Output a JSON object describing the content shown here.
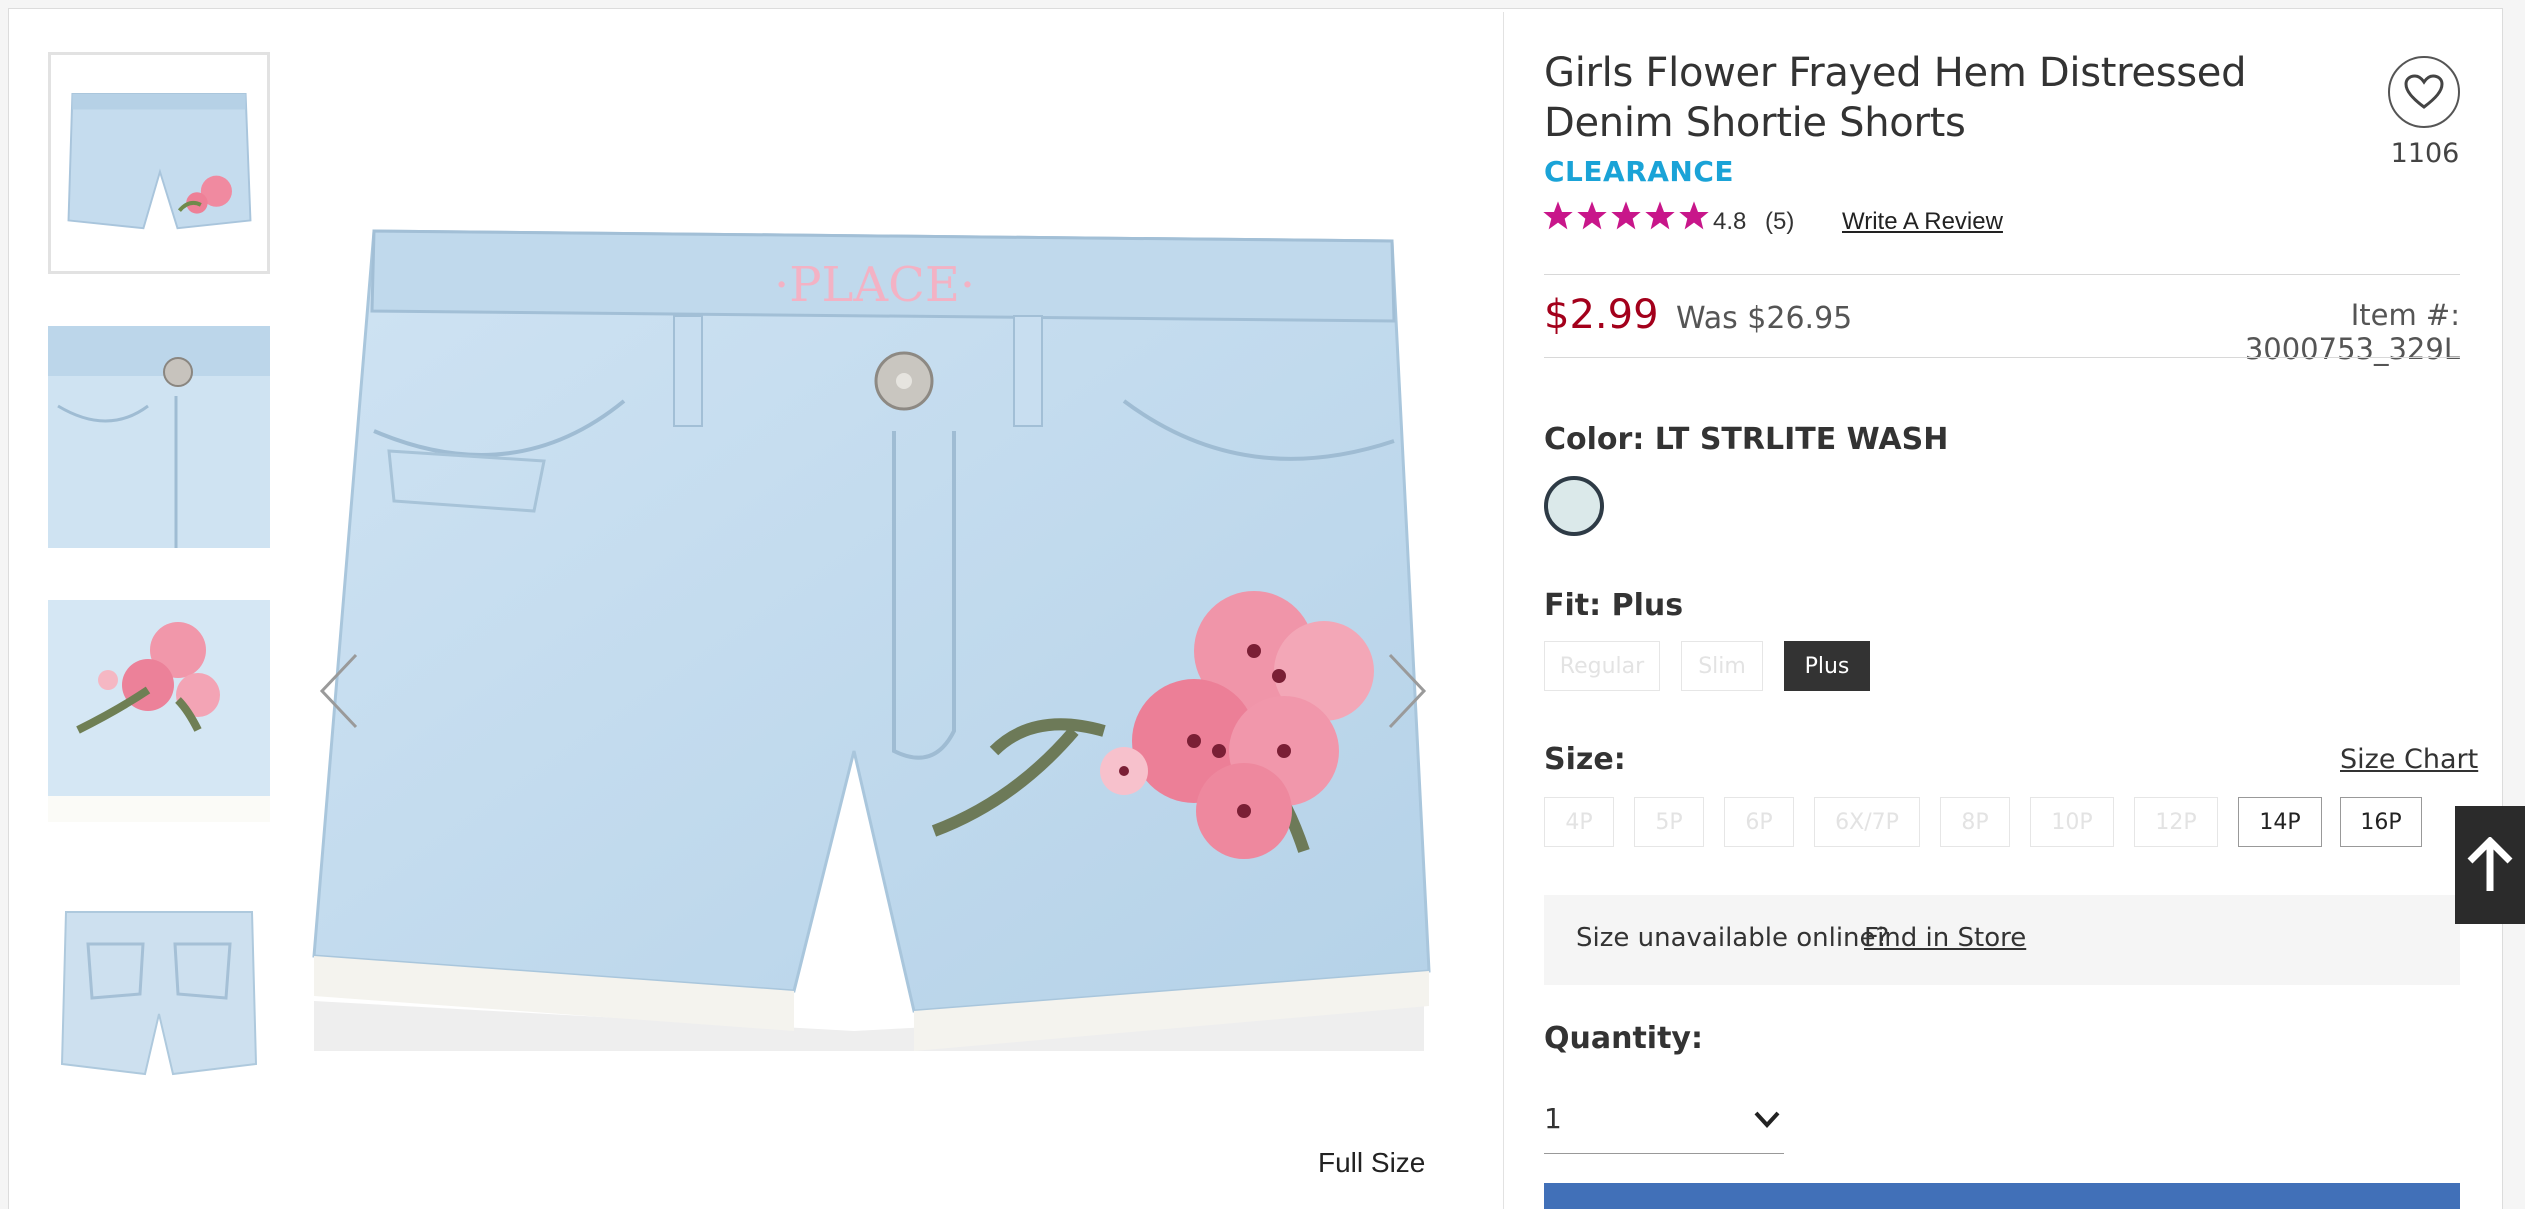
{
  "product": {
    "title": "Girls Flower Frayed Hem Distressed Denim Shortie Shorts",
    "badge": "CLEARANCE",
    "favorites_count": "1106",
    "rating": "4.8",
    "review_count": "(5)",
    "write_review_label": "Write A Review",
    "price": "$2.99",
    "was_price": "Was $26.95",
    "item_number": "Item #: 3000753_329L"
  },
  "gallery": {
    "full_size_label": "Full Size",
    "thumbnails": [
      "front",
      "waist-detail",
      "flower-detail",
      "back"
    ],
    "active_index": 0
  },
  "color": {
    "label": "Color:",
    "value": "LT STRLITE WASH",
    "swatch_color": "#dbe9ea"
  },
  "fit": {
    "label": "Fit:",
    "value": "Plus",
    "options": [
      {
        "label": "Regular",
        "available": false,
        "selected": false
      },
      {
        "label": "Slim",
        "available": false,
        "selected": false
      },
      {
        "label": "Plus",
        "available": true,
        "selected": true
      }
    ]
  },
  "size": {
    "label": "Size:",
    "size_chart_label": "Size Chart",
    "options": [
      {
        "label": "4P",
        "available": false
      },
      {
        "label": "5P",
        "available": false
      },
      {
        "label": "6P",
        "available": false
      },
      {
        "label": "6X/7P",
        "available": false
      },
      {
        "label": "8P",
        "available": false
      },
      {
        "label": "10P",
        "available": false
      },
      {
        "label": "12P",
        "available": false
      },
      {
        "label": "14P",
        "available": true
      },
      {
        "label": "16P",
        "available": true
      }
    ],
    "unavailable_text": "Size unavailable online?",
    "find_in_store_label": "Find in Store"
  },
  "quantity": {
    "label": "Quantity:",
    "value": "1"
  },
  "colors": {
    "accent_price": "#a3001b",
    "clearance": "#1aa3d7",
    "stars": "#c8168a",
    "add_to_bag": "#4170b8",
    "selected_option": "#333333"
  },
  "icons": {
    "favorite": "heart-outline-icon",
    "prev": "chevron-left-icon",
    "next": "chevron-right-icon",
    "quantity_dropdown": "chevron-down-icon",
    "back_to_top": "arrow-up-icon"
  }
}
